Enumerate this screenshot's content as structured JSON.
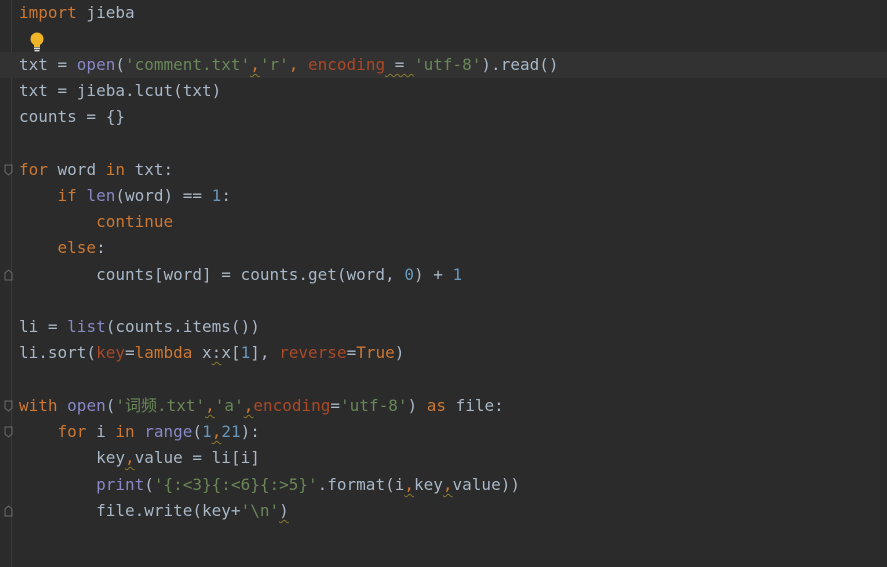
{
  "editor": {
    "lines": {
      "l1": {
        "a": "import",
        "b": " jieba"
      },
      "l3": {
        "a": "txt = ",
        "b": "open",
        "c": "(",
        "d": "'comment.txt'",
        "e": ",",
        "f": "'r'",
        "g": ", ",
        "h": "encoding",
        "i": " = ",
        "j": "'utf-8'",
        "k": ").read()"
      },
      "l4": {
        "a": "txt = jieba.lcut(txt)"
      },
      "l5": {
        "a": "counts = {}"
      },
      "l7": {
        "a": "for",
        "b": " word ",
        "c": "in",
        "d": " txt:"
      },
      "l8": {
        "indent": "    ",
        "a": "if",
        "b": " ",
        "c": "len",
        "d": "(word) == ",
        "e": "1",
        "f": ":"
      },
      "l9": {
        "indent": "        ",
        "a": "continue"
      },
      "l10": {
        "indent": "    ",
        "a": "else",
        "b": ":"
      },
      "l11": {
        "indent": "        ",
        "a": "counts[word] = counts.get(word, ",
        "b": "0",
        "c": ") + ",
        "d": "1"
      },
      "l13": {
        "a": "li = ",
        "b": "list",
        "c": "(counts.items())"
      },
      "l14": {
        "a": "li.sort(",
        "b": "key",
        "c": "=",
        "d": "lambda",
        "e": " x",
        "f": ":",
        "g": "x[",
        "h": "1",
        "i": "], ",
        "j": "reverse",
        "k": "=",
        "l": "True",
        "m": ")"
      },
      "l16": {
        "a": "with",
        "b": " ",
        "c": "open",
        "d": "(",
        "e": "'词频.txt'",
        "f": ",",
        "g": "'a'",
        "h": ",",
        "i": "encoding",
        "j": "=",
        "k": "'utf-8'",
        "l": ") ",
        "m": "as",
        "n": " file:"
      },
      "l17": {
        "indent": "    ",
        "a": "for",
        "b": " i ",
        "c": "in",
        "d": " ",
        "e": "range",
        "f": "(",
        "g": "1",
        "h": ",",
        "i": "21",
        "j": "):"
      },
      "l18": {
        "indent": "        ",
        "a": "key",
        "b": ",",
        "c": "value = li[i]"
      },
      "l19": {
        "indent": "        ",
        "a": "print",
        "b": "(",
        "c": "'{:<3}{:<6}{:>5}'",
        "d": ".format(i",
        "e": ",",
        "f": "key",
        "g": ",",
        "h": "value))"
      },
      "l20": {
        "indent": "        ",
        "a": "file.write(key+",
        "b": "'\\n'",
        "c": ")"
      }
    },
    "icons": {
      "bulb": "lightbulb-icon",
      "fold": "fold-marker-icon"
    },
    "colors": {
      "background": "#2b2b2b",
      "keyword": "#cc7832",
      "builtin": "#8888c6",
      "string": "#6a8759",
      "number": "#6897bb",
      "parameter": "#aa4926",
      "text": "#a9b7c6",
      "bulb": "#f0b429"
    }
  }
}
